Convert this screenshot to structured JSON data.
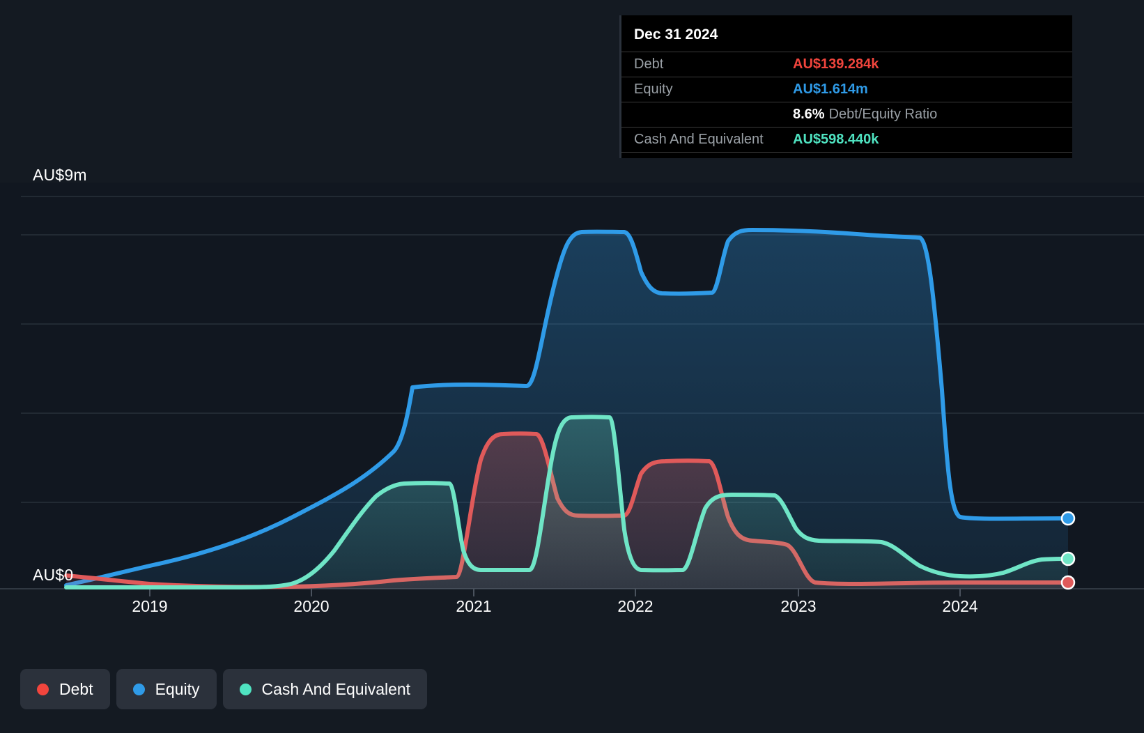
{
  "axis": {
    "y_top_label": "AU$9m",
    "y_bottom_label": "AU$0",
    "x_ticks": [
      "2019",
      "2020",
      "2021",
      "2022",
      "2023",
      "2024"
    ]
  },
  "tooltip": {
    "title": "Dec 31 2024",
    "rows": [
      {
        "key": "Debt",
        "value": "AU$139.284k",
        "color": "#f2453d"
      },
      {
        "key": "Equity",
        "value": "AU$1.614m",
        "color": "#2f9be8"
      }
    ],
    "ratio_pct": "8.6%",
    "ratio_label": "Debt/Equity Ratio",
    "cash_key": "Cash And Equivalent",
    "cash_value": "AU$598.440k",
    "cash_color": "#4fe3c1"
  },
  "legend": [
    {
      "label": "Debt",
      "color": "#f2453d"
    },
    {
      "label": "Equity",
      "color": "#2f9be8"
    },
    {
      "label": "Cash And Equivalent",
      "color": "#4fe3c1"
    }
  ],
  "colors": {
    "background": "#141a22",
    "plot_background": "#111720",
    "gridline": "#343c46",
    "debt": "#e05a5a",
    "equity": "#2f9be8",
    "cash": "#6fe5c6",
    "tooltip_background": "#000000"
  },
  "chart_data": {
    "type": "area",
    "title": "Debt, Equity and Cash And Equivalent over time",
    "xlabel": "",
    "ylabel": "AU$",
    "ylim": [
      0,
      9000000
    ],
    "ytick_labels": [
      "AU$0",
      "AU$9m"
    ],
    "xlim": [
      "2018-06-30",
      "2025-03-31"
    ],
    "grid": true,
    "legend_position": "bottom-left",
    "x": [
      "2018-06-30",
      "2018-12-31",
      "2019-06-30",
      "2019-12-31",
      "2020-06-30",
      "2020-12-31",
      "2021-06-30",
      "2021-12-31",
      "2022-06-30",
      "2022-12-31",
      "2023-06-30",
      "2023-12-31",
      "2024-06-30",
      "2024-12-31",
      "2025-03-31"
    ],
    "series": [
      {
        "name": "Debt",
        "color": "#e05a5a",
        "units": "AU$",
        "values": [
          180000,
          90000,
          40000,
          40000,
          90000,
          110000,
          2100000,
          330000,
          1800000,
          1300000,
          160000,
          160000,
          90000,
          139284,
          139284
        ]
      },
      {
        "name": "Equity",
        "color": "#2f9be8",
        "units": "AU$",
        "values": [
          80000,
          430000,
          900000,
          1450000,
          2300000,
          4000000,
          4050000,
          7500000,
          6150000,
          7550000,
          7500000,
          7450000,
          1614000,
          1614000,
          1614000
        ]
      },
      {
        "name": "Cash And Equivalent",
        "color": "#6fe5c6",
        "units": "AU$",
        "values": [
          20000,
          20000,
          20000,
          30000,
          500000,
          2200000,
          2200000,
          330000,
          3350000,
          330000,
          1950000,
          1200000,
          330000,
          598440,
          598440
        ]
      }
    ]
  }
}
